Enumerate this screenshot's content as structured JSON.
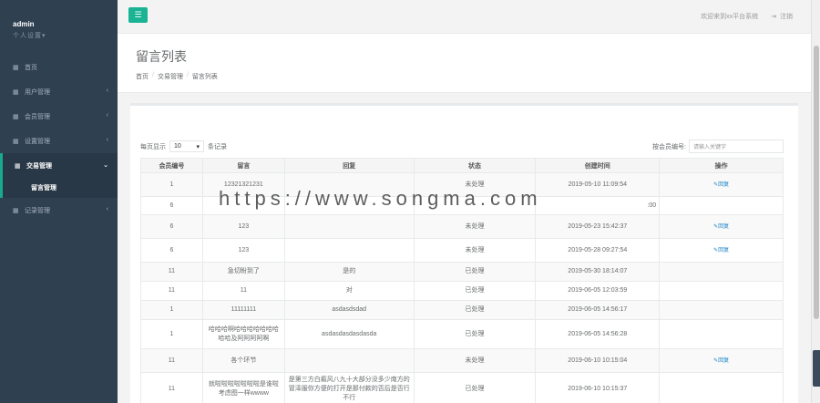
{
  "sidebar": {
    "user": "admin",
    "settings": "个人设置▾",
    "items": [
      {
        "label": "首页"
      },
      {
        "label": "用户管理"
      },
      {
        "label": "会员管理"
      },
      {
        "label": "设置管理"
      },
      {
        "label": "交易管理"
      },
      {
        "label": "记录管理"
      }
    ],
    "subitem": "留言管理"
  },
  "topbar": {
    "welcome": "欢迎来到xx平台系统",
    "logout": "注销"
  },
  "heading": {
    "title": "留言列表",
    "crumbs": [
      "首页",
      "交易管理",
      "留言列表"
    ]
  },
  "controls": {
    "prefix": "每页显示",
    "page_size": "10",
    "suffix": "条记录",
    "search_label": "按会员编号:",
    "search_placeholder": "请输入关键字"
  },
  "table": {
    "headers": [
      "会员编号",
      "留言",
      "回复",
      "状态",
      "创建时间",
      "操作"
    ],
    "rows": [
      {
        "id": "1",
        "msg": "12321321231",
        "reply": "",
        "status": "未处理",
        "time": "2019-05-10 11:09:54",
        "op": "✎回复"
      },
      {
        "id": "6",
        "msg": "",
        "reply": "",
        "status": "",
        "time": ":00",
        "op": ""
      },
      {
        "id": "6",
        "msg": "123",
        "reply": "",
        "status": "未处理",
        "time": "2019-05-23 15:42:37",
        "op": "✎回复"
      },
      {
        "id": "6",
        "msg": "123",
        "reply": "",
        "status": "未处理",
        "time": "2019-05-28 09:27:54",
        "op": "✎回复"
      },
      {
        "id": "11",
        "msg": "急切盼到了",
        "reply": "是的",
        "status": "已处理",
        "time": "2019-05-30 18:14:07",
        "op": ""
      },
      {
        "id": "11",
        "msg": "11",
        "reply": "对",
        "status": "已处理",
        "time": "2019-06-05 12:03:59",
        "op": ""
      },
      {
        "id": "1",
        "msg": "11111111",
        "reply": "asdasdsdad",
        "status": "已处理",
        "time": "2019-06-05 14:56:17",
        "op": ""
      },
      {
        "id": "1",
        "msg": "哈哈哈啊哈哈哈哈哈哈哈哈哈及阿阿阿阿啊",
        "reply": "asdasdasdasdasda",
        "status": "已处理",
        "time": "2019-06-05 14:56:28",
        "op": ""
      },
      {
        "id": "11",
        "msg": "各个环节",
        "reply": "",
        "status": "未处理",
        "time": "2019-06-10 10:15:04",
        "op": "✎回复"
      },
      {
        "id": "11",
        "msg": "就啦啦啦啦啦啦啦是谁啦考虑图一样wwww",
        "reply": "是第三方白癜风八九十大部分没多少南方的冒泽服你方便的打开是那付款的否后是否行不行",
        "status": "已处理",
        "time": "2019-06-10 10:15:37",
        "op": ""
      }
    ]
  },
  "watermark": "https://www.songma.com"
}
